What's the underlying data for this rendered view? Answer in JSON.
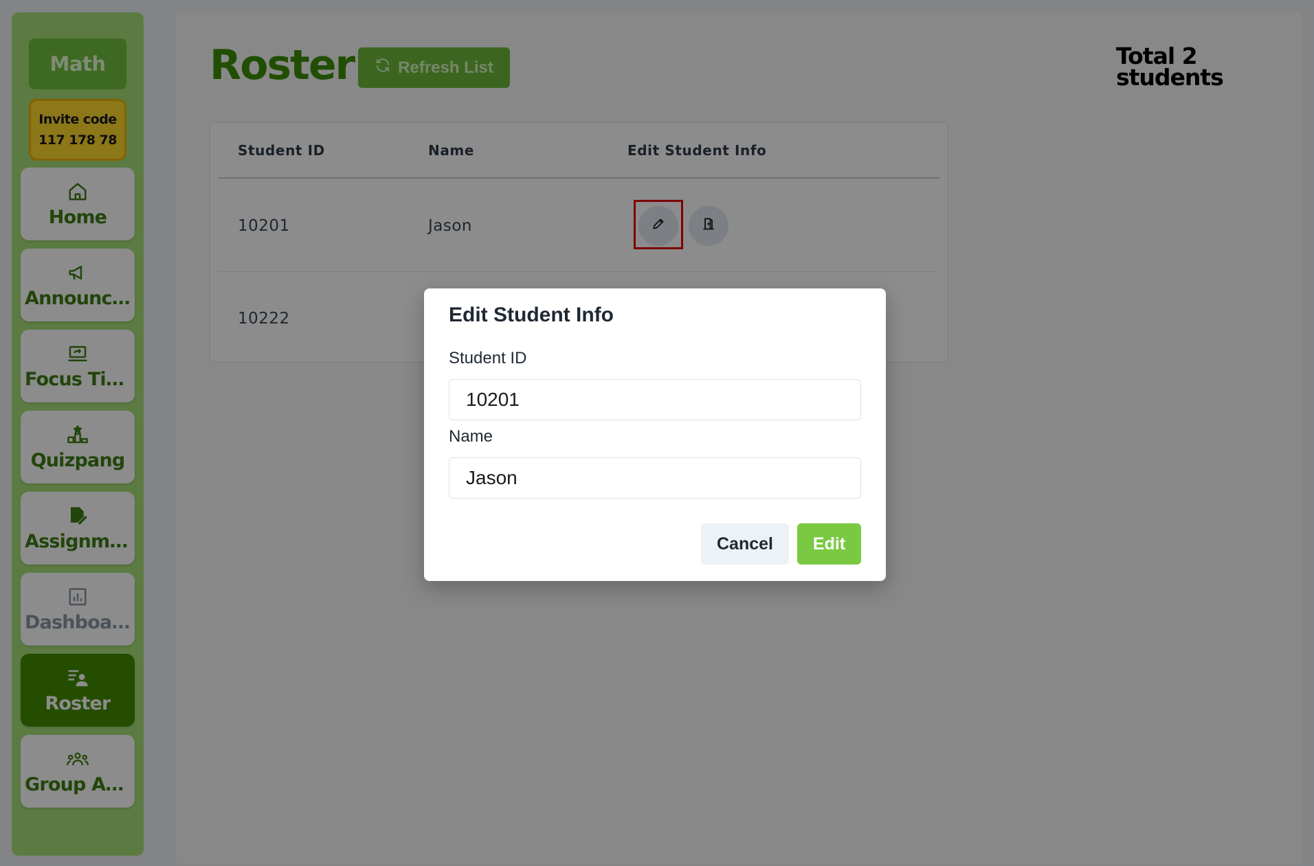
{
  "sidebar": {
    "class_name": "Math",
    "invite_label": "Invite code",
    "invite_code": "117 178 78",
    "items": [
      {
        "label": "Home",
        "icon": "home-icon"
      },
      {
        "label": "Announcements",
        "icon": "megaphone-icon"
      },
      {
        "label": "Focus Time",
        "icon": "laptop-icon"
      },
      {
        "label": "Quizpang",
        "icon": "podium-icon"
      },
      {
        "label": "Assignments",
        "icon": "file-edit-icon"
      },
      {
        "label": "Dashboard",
        "icon": "bar-chart-icon"
      },
      {
        "label": "Roster",
        "icon": "roster-icon"
      },
      {
        "label": "Group Activities",
        "icon": "group-icon"
      }
    ],
    "active_item": "Roster",
    "disabled_item": "Dashboard"
  },
  "header": {
    "title": "Roster",
    "refresh_label": "Refresh List",
    "total_line1": "Total 2",
    "total_line2": "students"
  },
  "table": {
    "columns": [
      "Student ID",
      "Name",
      "Edit Student Info"
    ],
    "rows": [
      {
        "id": "10201",
        "name": "Jason"
      },
      {
        "id": "10222",
        "name": ""
      }
    ],
    "row_actions": [
      "pencil-icon",
      "door-icon"
    ]
  },
  "modal": {
    "title": "Edit Student Info",
    "id_label": "Student ID",
    "id_value": "10201",
    "name_label": "Name",
    "name_value": "Jason",
    "cancel_label": "Cancel",
    "edit_label": "Edit"
  },
  "colors": {
    "sidebar_bg": "#a7e07a",
    "brand_green": "#3f8f08",
    "active_nav": "#428d00",
    "invite_yellow": "#ffd92e",
    "edit_button": "#7ac943",
    "highlight": "#e20000"
  }
}
